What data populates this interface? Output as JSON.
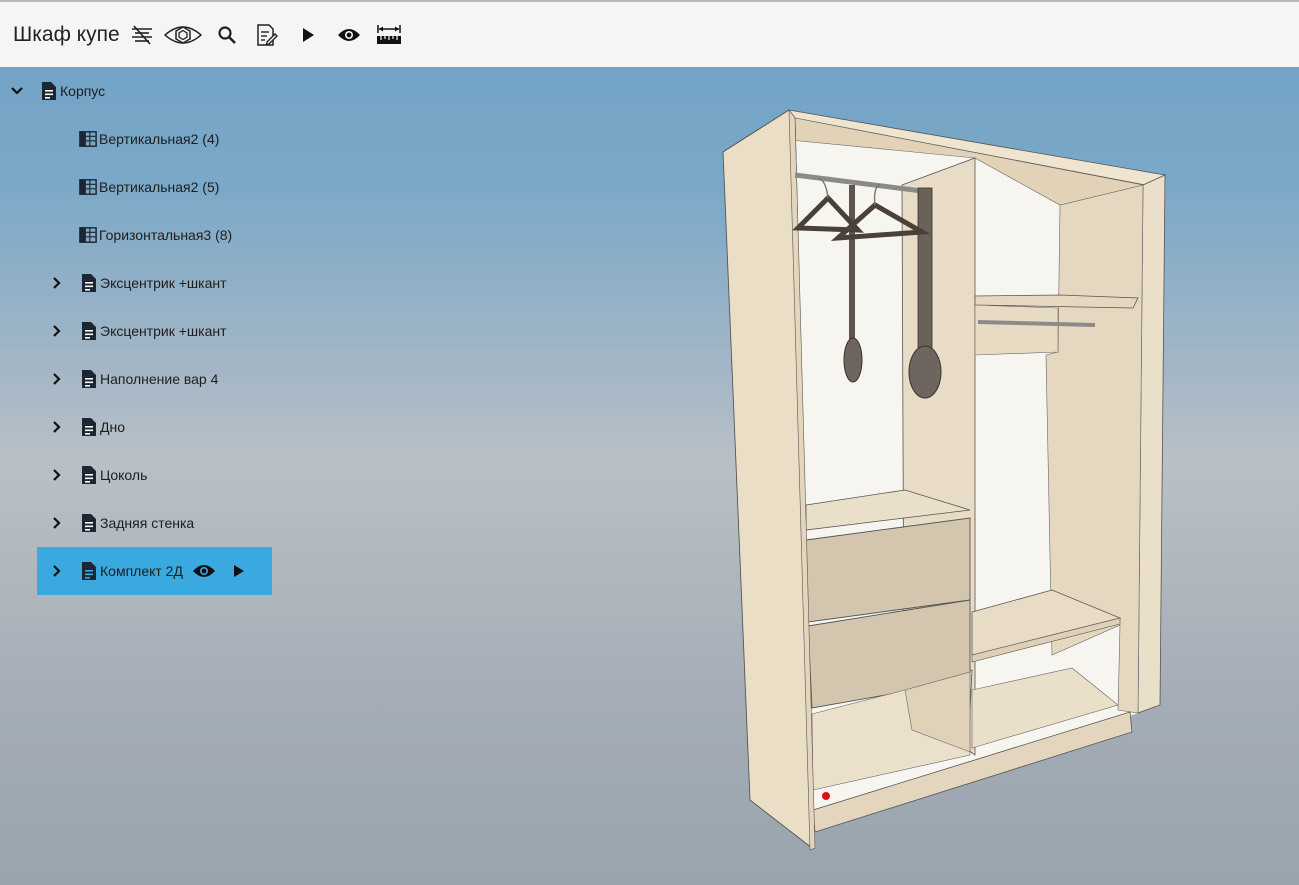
{
  "header": {
    "title": "Шкаф купе",
    "toolbar": [
      {
        "name": "filter-lines-icon"
      },
      {
        "name": "perspective-eye-icon"
      },
      {
        "name": "search-icon"
      },
      {
        "name": "edit-document-icon"
      },
      {
        "name": "play-icon"
      },
      {
        "name": "visibility-eye-icon"
      },
      {
        "name": "ruler-measure-icon"
      }
    ]
  },
  "tree": {
    "root": {
      "label": "Корпус",
      "expanded": true,
      "icon": "document-icon"
    },
    "items": [
      {
        "label": "Вертикальная2 (4)",
        "icon": "grid-panel-icon",
        "expandable": false
      },
      {
        "label": "Вертикальная2 (5)",
        "icon": "grid-panel-icon",
        "expandable": false
      },
      {
        "label": "Горизонтальная3 (8)",
        "icon": "grid-panel-icon",
        "expandable": false
      },
      {
        "label": "Эксцентрик +шкант",
        "icon": "document-icon",
        "expandable": true
      },
      {
        "label": "Эксцентрик +шкант",
        "icon": "document-icon",
        "expandable": true
      },
      {
        "label": "Наполнение вар 4",
        "icon": "document-icon",
        "expandable": true
      },
      {
        "label": "Дно",
        "icon": "document-icon",
        "expandable": true
      },
      {
        "label": "Цоколь",
        "icon": "document-icon",
        "expandable": true
      },
      {
        "label": "Задняя стенка",
        "icon": "document-icon",
        "expandable": true
      },
      {
        "label": "Комплект 2Д",
        "icon": "document-icon",
        "expandable": true,
        "selected": true
      }
    ]
  },
  "colors": {
    "selected_row": "#3aa9e0",
    "wood_light": "#e9dcc6",
    "wood_shade": "#d9c9ad",
    "drawer_front": "#d4c6ae"
  }
}
